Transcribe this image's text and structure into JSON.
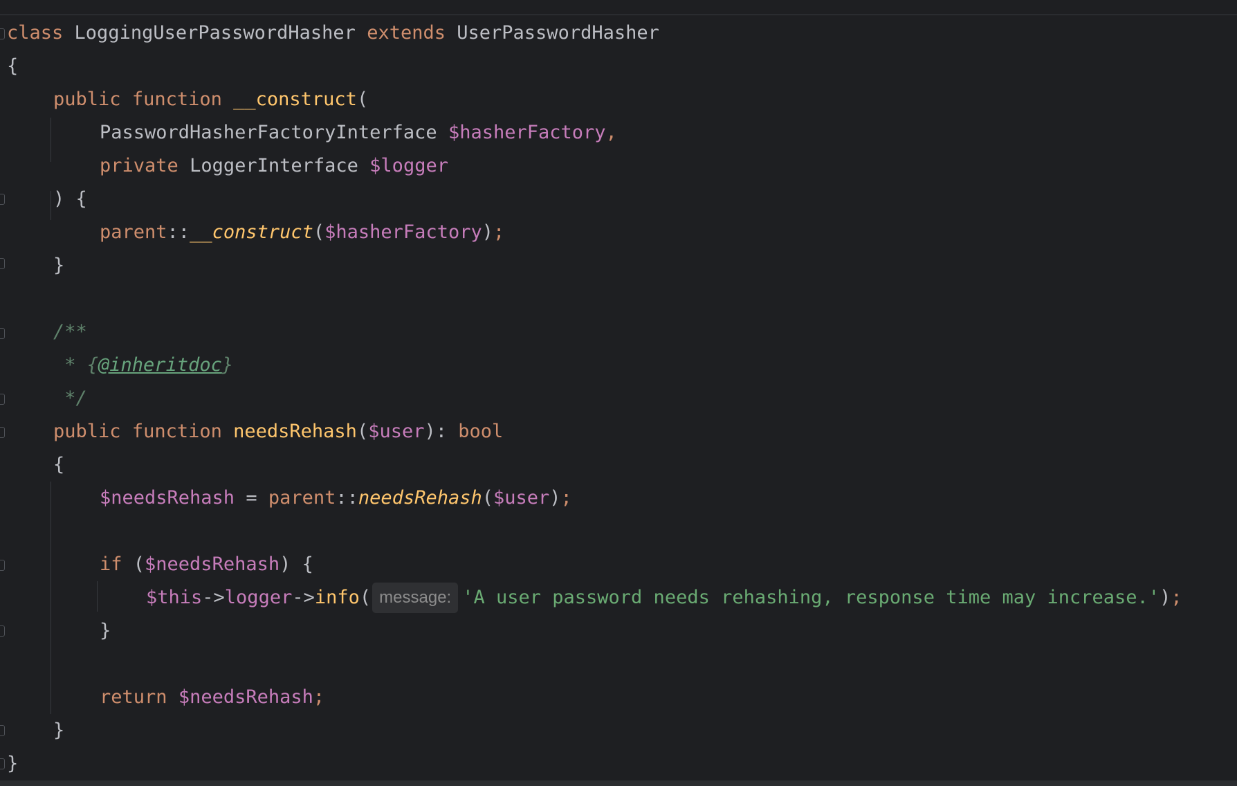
{
  "editor": {
    "language": "PHP",
    "theme_colors": {
      "background": "#1e1f22",
      "keyword": "#cf8e6d",
      "identifier": "#bcbec4",
      "function": "#ffc66d",
      "variable": "#c77dbb",
      "string": "#6aab73",
      "comment": "#5f826b"
    },
    "lines": {
      "l1": {
        "kw_class": "class",
        "class_name": "LoggingUserPasswordHasher",
        "kw_extends": "extends",
        "parent_name": "UserPasswordHasher"
      },
      "l2": {
        "brace": "{"
      },
      "l3": {
        "kw_public": "public",
        "kw_function": "function",
        "fn_name": "__construct",
        "paren": "("
      },
      "l4": {
        "type": "PasswordHasherFactoryInterface",
        "var": "$hasherFactory",
        "comma": ","
      },
      "l5": {
        "kw_private": "private",
        "type": "LoggerInterface",
        "var": "$logger"
      },
      "l6": {
        "text": ") {"
      },
      "l7": {
        "kw_parent": "parent",
        "sep": "::",
        "fn_name": "__construct",
        "open": "(",
        "var": "$hasherFactory",
        "close": ")",
        "semi": ";"
      },
      "l8": {
        "brace": "}"
      },
      "l10": {
        "text": "/**"
      },
      "l11": {
        "prefix": " * {",
        "tag": "@inheritdoc",
        "suffix": "}"
      },
      "l12": {
        "text": " */"
      },
      "l13": {
        "kw_public": "public",
        "kw_function": "function",
        "fn_name": "needsRehash",
        "open": "(",
        "var": "$user",
        "close": "): ",
        "return_type": "bool"
      },
      "l14": {
        "brace": "{"
      },
      "l15": {
        "var": "$needsRehash",
        "assign": " = ",
        "kw_parent": "parent",
        "sep": "::",
        "fn_name": "needsRehash",
        "open": "(",
        "arg": "$user",
        "close": ")",
        "semi": ";"
      },
      "l17": {
        "kw_if": "if",
        "open": " (",
        "var": "$needsRehash",
        "close": ") {"
      },
      "l18": {
        "var_this": "$this",
        "arrow1": "->",
        "prop": "logger",
        "arrow2": "->",
        "method": "info",
        "open": "(",
        "hint": "message:",
        "string": "'A user password needs rehashing, response time may increase.'",
        "close": ")",
        "semi": ";"
      },
      "l19": {
        "brace": "}"
      },
      "l21": {
        "kw_return": "return",
        "var": "$needsRehash",
        "semi": ";"
      },
      "l22": {
        "brace": "}"
      },
      "l23": {
        "brace": "}"
      }
    }
  }
}
